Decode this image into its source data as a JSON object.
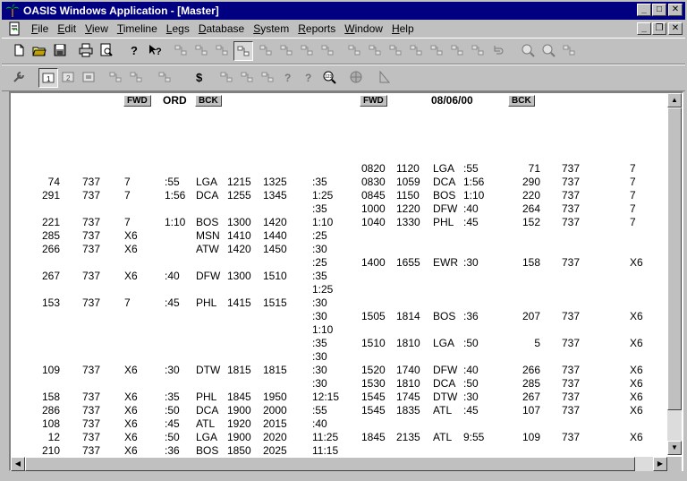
{
  "window": {
    "title": "OASIS Windows Application - [Master]"
  },
  "menu": [
    {
      "label": "File",
      "u": "F",
      "rest": "ile"
    },
    {
      "label": "Edit",
      "u": "E",
      "rest": "dit"
    },
    {
      "label": "View",
      "u": "V",
      "rest": "iew"
    },
    {
      "label": "Timeline",
      "u": "T",
      "rest": "imeline"
    },
    {
      "label": "Legs",
      "u": "L",
      "rest": "egs"
    },
    {
      "label": "Database",
      "u": "D",
      "rest": "atabase"
    },
    {
      "label": "System",
      "u": "S",
      "rest": "ystem"
    },
    {
      "label": "Reports",
      "u": "R",
      "rest": "eports"
    },
    {
      "label": "Window",
      "u": "W",
      "rest": "indow"
    },
    {
      "label": "Help",
      "u": "H",
      "rest": "elp"
    }
  ],
  "toolbar1": [
    "new-file-icon",
    "open-folder-icon",
    "save-disk-icon",
    "print-icon",
    "print-preview-icon",
    "help-question-icon",
    "context-help-icon",
    "leg-forward-icon",
    "leg-back-icon",
    "leg-insert-icon",
    "leg-delete-icon",
    "column-highlight-icon",
    "column-box-icon",
    "split-icon",
    "stack-icon",
    "grid-icon",
    "cross-icon",
    "join-icon",
    "connect-icon",
    "check-circle-icon",
    "stop-circle-icon",
    "link-dots-icon",
    "undo-icon",
    "zoom-in-icon",
    "zoom-out-icon",
    "tile-icon"
  ],
  "toolbar2": [
    "wrench-icon",
    "view-one-icon",
    "view-two-icon",
    "view-three-icon",
    "sequence-icon",
    "gauge-icon",
    "swap-icon",
    "dollar-icon",
    "schedule-a-icon",
    "schedule-b-icon",
    "time-arrow-icon",
    "question-a-icon",
    "question-b-icon",
    "search-123-icon",
    "globe-icon",
    "ruler-triangle-icon"
  ],
  "left_panel": {
    "header": {
      "fwd": "FWD",
      "station": "ORD",
      "bck": "BCK"
    },
    "rows": [
      {
        "row": 0,
        "fare": "74",
        "eq": "737",
        "cls": "7",
        "blk": ":55",
        "sta": "LGA",
        "dep": "1215",
        "arr": "1325",
        "gap": ":35"
      },
      {
        "row": 1,
        "fare": "291",
        "eq": "737",
        "cls": "7",
        "blk": "1:56",
        "sta": "DCA",
        "dep": "1255",
        "arr": "1345",
        "gap": "1:25"
      },
      {
        "row": 2,
        "gap": ":35"
      },
      {
        "row": 3,
        "fare": "221",
        "eq": "737",
        "cls": "7",
        "blk": "1:10",
        "sta": "BOS",
        "dep": "1300",
        "arr": "1420",
        "gap": "1:10"
      },
      {
        "row": 4,
        "fare": "285",
        "eq": "737",
        "cls": "X6",
        "blk": "",
        "sta": "MSN",
        "dep": "1410",
        "arr": "1440",
        "gap": ":25"
      },
      {
        "row": 5,
        "fare": "266",
        "eq": "737",
        "cls": "X6",
        "blk": "",
        "sta": "ATW",
        "dep": "1420",
        "arr": "1450",
        "gap": ":30"
      },
      {
        "row": 6,
        "gap": ":25"
      },
      {
        "row": 7,
        "fare": "267",
        "eq": "737",
        "cls": "X6",
        "blk": ":40",
        "sta": "DFW",
        "dep": "1300",
        "arr": "1510",
        "gap": ":35"
      },
      {
        "row": 8,
        "gap": "1:25"
      },
      {
        "row": 9,
        "fare": "153",
        "eq": "737",
        "cls": "7",
        "blk": ":45",
        "sta": "PHL",
        "dep": "1415",
        "arr": "1515",
        "gap": ":30"
      },
      {
        "row": 10,
        "gap": ":30"
      },
      {
        "row": 11,
        "gap": "1:10"
      },
      {
        "row": 12,
        "gap": ":35"
      },
      {
        "row": 13,
        "gap": ":30"
      },
      {
        "row": 14,
        "fare": "109",
        "eq": "737",
        "cls": "X6",
        "blk": ":30",
        "sta": "DTW",
        "dep": "1815",
        "arr": "1815",
        "gap": ":30"
      },
      {
        "row": 15,
        "gap": ":30"
      },
      {
        "row": 16,
        "fare": "158",
        "eq": "737",
        "cls": "X6",
        "blk": ":35",
        "sta": "PHL",
        "dep": "1845",
        "arr": "1950",
        "gap": "12:15"
      },
      {
        "row": 17,
        "fare": "286",
        "eq": "737",
        "cls": "X6",
        "blk": ":50",
        "sta": "DCA",
        "dep": "1900",
        "arr": "2000",
        "gap": ":55"
      },
      {
        "row": 18,
        "fare": "108",
        "eq": "737",
        "cls": "X6",
        "blk": ":45",
        "sta": "ATL",
        "dep": "1920",
        "arr": "2015",
        "gap": ":40"
      },
      {
        "row": 19,
        "fare": "12",
        "eq": "737",
        "cls": "X6",
        "blk": ":50",
        "sta": "LGA",
        "dep": "1900",
        "arr": "2020",
        "gap": "11:25"
      },
      {
        "row": 20,
        "fare": "210",
        "eq": "737",
        "cls": "X6",
        "blk": ":36",
        "sta": "BOS",
        "dep": "1850",
        "arr": "2025",
        "gap": "11:15"
      }
    ]
  },
  "right_panel": {
    "header": {
      "fwd": "FWD",
      "date": "08/06/00",
      "bck": "BCK"
    },
    "rows": [
      {
        "row": -1,
        "dep": "0820",
        "arr": "1120",
        "sta": "LGA",
        "blk": ":55",
        "fare": "71",
        "eq": "737",
        "cls": "7"
      },
      {
        "row": 0,
        "dep": "0830",
        "arr": "1059",
        "sta": "DCA",
        "blk": "1:56",
        "fare": "290",
        "eq": "737",
        "cls": "7"
      },
      {
        "row": 1,
        "dep": "0845",
        "arr": "1150",
        "sta": "BOS",
        "blk": "1:10",
        "fare": "220",
        "eq": "737",
        "cls": "7"
      },
      {
        "row": 2,
        "dep": "1000",
        "arr": "1220",
        "sta": "DFW",
        "blk": ":40",
        "fare": "264",
        "eq": "737",
        "cls": "7"
      },
      {
        "row": 3,
        "dep": "1040",
        "arr": "1330",
        "sta": "PHL",
        "blk": ":45",
        "fare": "152",
        "eq": "737",
        "cls": "7"
      },
      {
        "row": 6,
        "dep": "1400",
        "arr": "1655",
        "sta": "EWR",
        "blk": ":30",
        "fare": "158",
        "eq": "737",
        "cls": "X6"
      },
      {
        "row": 10,
        "dep": "1505",
        "arr": "1814",
        "sta": "BOS",
        "blk": ":36",
        "fare": "207",
        "eq": "737",
        "cls": "X6"
      },
      {
        "row": 12,
        "dep": "1510",
        "arr": "1810",
        "sta": "LGA",
        "blk": ":50",
        "fare": "5",
        "eq": "737",
        "cls": "X6"
      },
      {
        "row": 14,
        "dep": "1520",
        "arr": "1740",
        "sta": "DFW",
        "blk": ":40",
        "fare": "266",
        "eq": "737",
        "cls": "X6"
      },
      {
        "row": 15,
        "dep": "1530",
        "arr": "1810",
        "sta": "DCA",
        "blk": ":50",
        "fare": "285",
        "eq": "737",
        "cls": "X6"
      },
      {
        "row": 16,
        "dep": "1545",
        "arr": "1745",
        "sta": "DTW",
        "blk": ":30",
        "fare": "267",
        "eq": "737",
        "cls": "X6"
      },
      {
        "row": 17,
        "dep": "1545",
        "arr": "1835",
        "sta": "ATL",
        "blk": ":45",
        "fare": "107",
        "eq": "737",
        "cls": "X6"
      },
      {
        "row": 19,
        "dep": "1845",
        "arr": "2135",
        "sta": "ATL",
        "blk": "9:55",
        "fare": "109",
        "eq": "737",
        "cls": "X6"
      }
    ]
  }
}
